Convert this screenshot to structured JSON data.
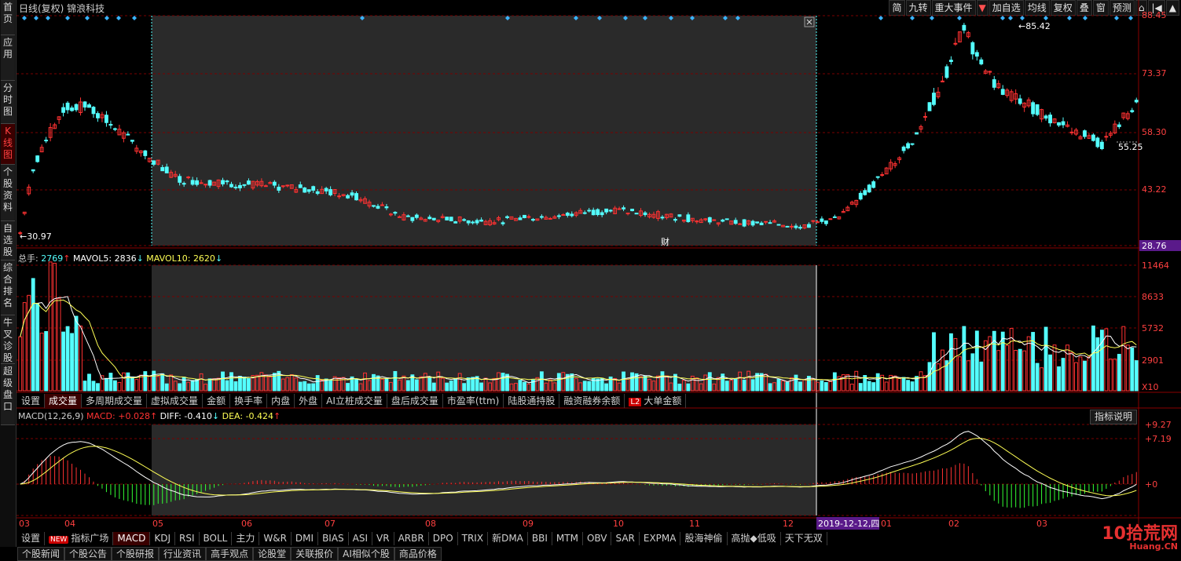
{
  "title": "日线(复权)  锦浪科技",
  "sidebar": [
    "首页",
    "应用",
    "分时图",
    "K线图",
    "个股资料",
    "自选股",
    "综合排名",
    "牛叉诊股",
    "超级盘口"
  ],
  "sidebar_active_index": 3,
  "toolbar": [
    "简",
    "九转",
    "重大事件",
    "▼",
    "加自选",
    "均线",
    "复权",
    "叠",
    "窗",
    "预测",
    "⌂",
    "|◀",
    "▲"
  ],
  "price_axis": [
    "88.45",
    "73.37",
    "58.30",
    "43.22",
    "28.76"
  ],
  "price_markers": {
    "high": "85.42",
    "low": "30.97",
    "last": "55.25"
  },
  "volume_legend": {
    "label": "总手:",
    "total": "2769",
    "mavol5_label": "MAVOL5:",
    "mavol5": "2836",
    "mavol10_label": "MAVOL10:",
    "mavol10": "2620"
  },
  "volume_axis": [
    "11464",
    "8633",
    "5732",
    "2901",
    "X10"
  ],
  "volume_tabs": [
    "设置",
    "成交量",
    "多周期成交量",
    "虚拟成交量",
    "金额",
    "换手率",
    "内盘",
    "外盘",
    "AI立桩成交量",
    "盘后成交量",
    "市盈率(ttm)",
    "陆股通持股",
    "融资融券余额",
    "大单金额"
  ],
  "volume_tab_active": 1,
  "l2_badge": "L2",
  "macd_legend": {
    "name": "MACD(12,26,9)",
    "macd_label": "MACD:",
    "macd": "+0.028",
    "diff_label": "DIFF:",
    "diff": "-0.410",
    "dea_label": "DEA:",
    "dea": "-0.424"
  },
  "macd_axis": [
    "+9.27",
    "+7.19",
    "+0"
  ],
  "help_button": "指标说明",
  "date_axis": [
    "03",
    "04",
    "05",
    "06",
    "07",
    "08",
    "09",
    "10",
    "11",
    "12",
    "01",
    "02",
    "03"
  ],
  "date_cursor": "2019-12-12,四",
  "indicator_tabs": [
    "设置",
    "指标广场",
    "MACD",
    "KDJ",
    "RSI",
    "BOLL",
    "主力",
    "W&R",
    "DMI",
    "BIAS",
    "ASI",
    "VR",
    "ARBR",
    "DPO",
    "TRIX",
    "新DMA",
    "BBI",
    "MTM",
    "OBV",
    "SAR",
    "EXPMA",
    "股海神偷",
    "高抛◆低吸",
    "天下无双"
  ],
  "indicator_tab_active": 2,
  "new_badge": "NEW",
  "bottom_tabs": [
    "个股新闻",
    "个股公告",
    "个股研报",
    "行业资讯",
    "高手观点",
    "论股堂",
    "关联报价",
    "AI相似个股",
    "商品价格"
  ],
  "watermark": {
    "brand": "10拾荒网",
    "url": "Huang.CN"
  },
  "caijiu_marker": "财",
  "colors": {
    "up": "#ff3232",
    "down": "#54ffff",
    "ma5": "#ffffff",
    "ma10": "#ffff55",
    "grid": "#7a0000",
    "selection": "#2a2a2a"
  }
}
